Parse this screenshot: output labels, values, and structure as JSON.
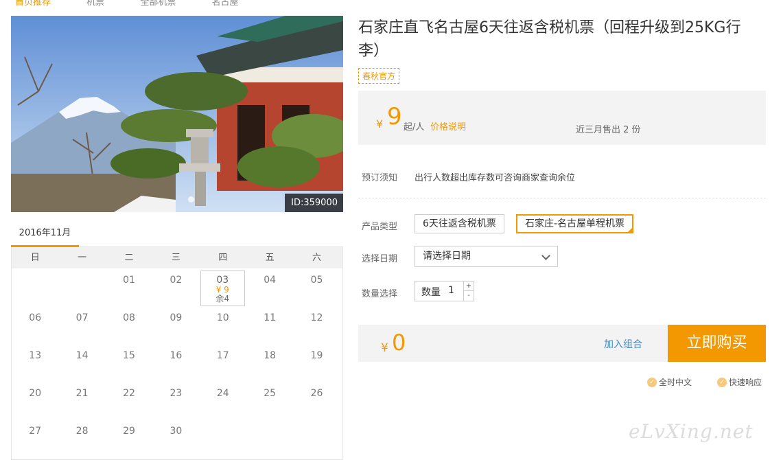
{
  "breadcrumb": [
    "首页推荐",
    "机票",
    "全部机票",
    "名古屋"
  ],
  "photo": {
    "id_badge": "ID:359000"
  },
  "calendar": {
    "month_tab": "2016年11月",
    "weekdays": [
      "日",
      "一",
      "二",
      "三",
      "四",
      "五",
      "六"
    ],
    "days": [
      "",
      "",
      "01",
      "02",
      "03",
      "04",
      "05",
      "06",
      "07",
      "08",
      "09",
      "10",
      "11",
      "12",
      "13",
      "14",
      "15",
      "16",
      "17",
      "18",
      "19",
      "20",
      "21",
      "22",
      "23",
      "24",
      "25",
      "26",
      "27",
      "28",
      "29",
      "30",
      "",
      "",
      ""
    ],
    "active_day": {
      "price": "¥ 9",
      "remaining": "余4"
    }
  },
  "product": {
    "title": "石家庄直飞名古屋6天往返含税机票（回程升级到25KG行李）",
    "tag": "春秋官方"
  },
  "price": {
    "currency": "¥",
    "amount": "9",
    "unit": "起/人",
    "explain_link": "价格说明",
    "sold": "近三月售出 2 份"
  },
  "booking": {
    "notice_label": "预订须知",
    "notice_text": "出行人数超出库存数可咨询商家查询余位",
    "type_label": "产品类型",
    "type_options": [
      "6天往返含税机票",
      "石家庄-名古屋单程机票"
    ],
    "date_label": "选择日期",
    "date_placeholder": "请选择日期",
    "qty_label": "数量选择",
    "qty_prefix": "数量",
    "qty_value": "1",
    "plus": "+",
    "minus": "-"
  },
  "buy": {
    "currency": "¥",
    "total": "0",
    "combo_link": "加入组合",
    "buy_button": "立即购买"
  },
  "features": [
    "全时中文",
    "快速响应"
  ],
  "watermark": "eLvXing.net",
  "colors": {
    "accent": "#f39800",
    "link": "#3f89c8",
    "panel": "#f3f3f3"
  }
}
